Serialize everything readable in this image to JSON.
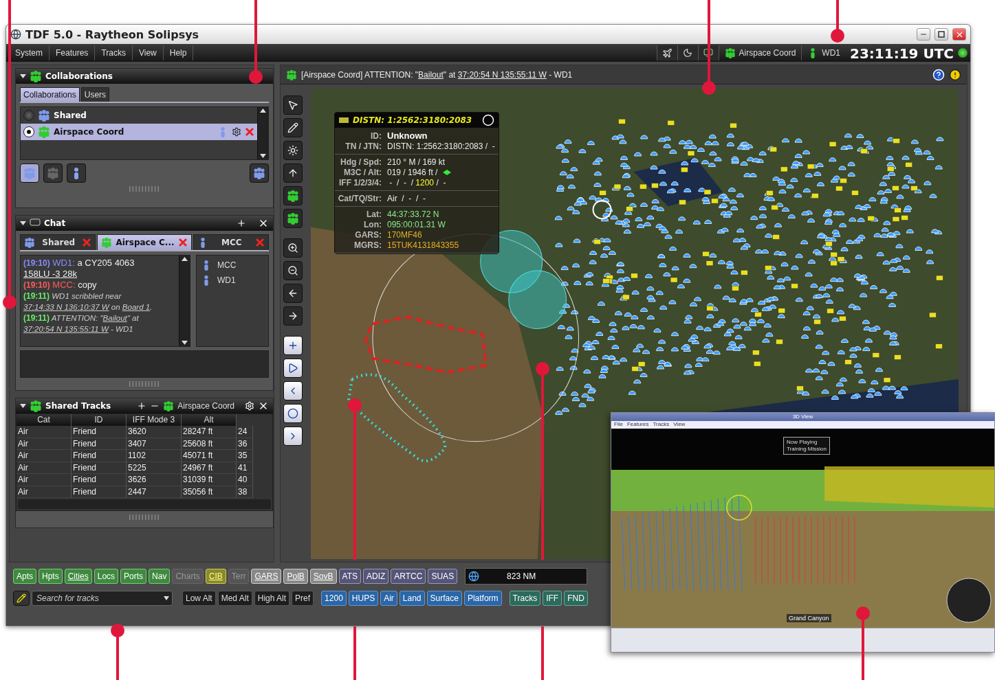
{
  "window": {
    "title": "TDF 5.0 - Raytheon Solipsys"
  },
  "menu": [
    "System",
    "Features",
    "Tracks",
    "View",
    "Help"
  ],
  "status": {
    "collaboration": "Airspace Coord",
    "user": "WD1",
    "clock": "23:11:19 UTC"
  },
  "alert": [
    {
      "text": "[Airspace Coord] ATTENTION: \"",
      "link": false
    },
    {
      "text": "Bailout",
      "link": true
    },
    {
      "text": "\" at ",
      "link": false
    },
    {
      "text": "37:20:54 N 135:55:11 W",
      "link": true
    },
    {
      "text": " - WD1",
      "link": false
    }
  ],
  "collaborations": {
    "title": "Collaborations",
    "tabs": [
      {
        "label": "Collaborations",
        "selected": true
      },
      {
        "label": "Users",
        "selected": false
      }
    ],
    "items": [
      {
        "name": "Shared",
        "selected": false,
        "color": "#7f9be8"
      },
      {
        "name": "Airspace Coord",
        "selected": true,
        "color": "#33cc33"
      }
    ]
  },
  "chat": {
    "title": "Chat",
    "tabs": [
      {
        "label": "Shared",
        "selected": false,
        "color": "#7f9be8"
      },
      {
        "label": "Airspace C...",
        "selected": true,
        "color": "#33cc33"
      },
      {
        "label": "MCC",
        "selected": false,
        "color": "#7f9be8"
      }
    ],
    "messages": [
      {
        "kind": "message",
        "time": "(19:10)",
        "sender": "WD1:",
        "color": "#8a8aff",
        "parts": [
          {
            "text": "a CY205 4063 ",
            "link": false
          },
          {
            "text": "158LU -3 28k",
            "link": true
          }
        ]
      },
      {
        "kind": "message",
        "time": "(19:10)",
        "sender": "MCC:",
        "color": "#ff5a5a",
        "parts": [
          {
            "text": "copy",
            "link": false
          }
        ]
      },
      {
        "kind": "event",
        "time": "(19:11)",
        "color": "#66ee66",
        "parts": [
          {
            "text": "WD1 scribbled near ",
            "link": false
          },
          {
            "text": "37:14:33 N 136:10:37 W",
            "link": true
          },
          {
            "text": " on ",
            "link": false
          },
          {
            "text": "Board 1",
            "link": true
          },
          {
            "text": ".",
            "link": false
          }
        ]
      },
      {
        "kind": "event",
        "time": "(19:11)",
        "color": "#66ee66",
        "parts": [
          {
            "text": "ATTENTION: \"",
            "link": false
          },
          {
            "text": "Bailout",
            "link": true
          },
          {
            "text": "\" at ",
            "link": false
          },
          {
            "text": "37:20:54 N 135:55:11 W",
            "link": true
          },
          {
            "text": " - WD1",
            "link": false
          }
        ]
      }
    ],
    "users": [
      "MCC",
      "WD1"
    ]
  },
  "shared_tracks": {
    "title": "Shared Tracks",
    "collaboration": "Airspace Coord",
    "columns": [
      "Cat",
      "ID",
      "IFF Mode 3",
      "Alt"
    ],
    "rows": [
      [
        "Air",
        "Friend",
        "3620",
        "28247 ft",
        "24"
      ],
      [
        "Air",
        "Friend",
        "3407",
        "25608 ft",
        "36"
      ],
      [
        "Air",
        "Friend",
        "1102",
        "45071 ft",
        "35"
      ],
      [
        "Air",
        "Friend",
        "5225",
        "24967 ft",
        "41"
      ],
      [
        "Air",
        "Friend",
        "3626",
        "31039 ft",
        "40"
      ],
      [
        "Air",
        "Friend",
        "2447",
        "35056 ft",
        "38"
      ]
    ]
  },
  "track_popup": {
    "title": "DISTN: 1:2562:3180:2083",
    "groups": [
      [
        {
          "label": "ID:",
          "parts": [
            {
              "text": "Unknown",
              "kind": "bold"
            }
          ]
        },
        {
          "label": "TN / JTN:",
          "parts": [
            {
              "text": "DISTN: 1:2562:3180:2083 /  -",
              "kind": "plain"
            }
          ]
        }
      ],
      [
        {
          "label": "Hdg / Spd:",
          "parts": [
            {
              "text": "210 ° M / 169 kt",
              "kind": "plain"
            }
          ]
        },
        {
          "label": "M3C / Alt:",
          "parts": [
            {
              "text": "019 / 1946 ft /",
              "kind": "plain"
            }
          ]
        },
        {
          "label": "IFF 1/2/3/4:",
          "parts": [
            {
              "text": " -  /  -  / ",
              "kind": "plain"
            },
            {
              "text": "1200",
              "kind": "yellow"
            },
            {
              "text": " /  -",
              "kind": "plain"
            }
          ]
        }
      ],
      [
        {
          "label": "Cat/TQ/Str:",
          "parts": [
            {
              "text": "Air  /  -  /  -",
              "kind": "plain"
            }
          ]
        }
      ],
      [
        {
          "label": "Lat:",
          "parts": [
            {
              "text": "44:37:33.72 N",
              "kind": "green"
            }
          ]
        },
        {
          "label": "Lon:",
          "parts": [
            {
              "text": "095:00:01.31 W",
              "kind": "green"
            }
          ]
        },
        {
          "label": "GARS:",
          "parts": [
            {
              "text": "170MF46",
              "kind": "orange"
            }
          ]
        },
        {
          "label": "MGRS:",
          "parts": [
            {
              "text": "15TUK4131843355",
              "kind": "orange"
            }
          ]
        }
      ]
    ]
  },
  "layers": [
    {
      "label": "Apts",
      "kind": "green",
      "disabled": false,
      "underlined": false
    },
    {
      "label": "Hpts",
      "kind": "green",
      "disabled": false,
      "underlined": false
    },
    {
      "label": "Cities",
      "kind": "green",
      "disabled": false,
      "underlined": true
    },
    {
      "label": "Locs",
      "kind": "green",
      "disabled": false,
      "underlined": false
    },
    {
      "label": "Ports",
      "kind": "green",
      "disabled": false,
      "underlined": false
    },
    {
      "label": "Nav",
      "kind": "green",
      "disabled": false,
      "underlined": false
    },
    {
      "label": "Charts",
      "kind": "green",
      "disabled": true,
      "underlined": false
    },
    {
      "label": "CIB",
      "kind": "olive",
      "disabled": false,
      "underlined": true
    },
    {
      "label": "Terr",
      "kind": "olive",
      "disabled": true,
      "underlined": false
    },
    {
      "label": "GARS",
      "kind": "white",
      "disabled": false,
      "underlined": true
    },
    {
      "label": "PolB",
      "kind": "white",
      "disabled": false,
      "underlined": true
    },
    {
      "label": "SovB",
      "kind": "white",
      "disabled": false,
      "underlined": true
    },
    {
      "label": "ATS",
      "kind": "purple",
      "disabled": false,
      "underlined": false
    },
    {
      "label": "ADIZ",
      "kind": "purple",
      "disabled": false,
      "underlined": false
    },
    {
      "label": "ARTCC",
      "kind": "purple",
      "disabled": false,
      "underlined": false
    },
    {
      "label": "SUAS",
      "kind": "purple",
      "disabled": false,
      "underlined": false
    }
  ],
  "scale": {
    "reading": "823 NM"
  },
  "search": {
    "placeholder": "Search for tracks"
  },
  "filter_groups": [
    {
      "kind": "dark",
      "buttons": [
        "Low Alt",
        "Med Alt",
        "High Alt",
        "Pref"
      ]
    },
    {
      "kind": "blue",
      "buttons": [
        "1200",
        "HUPS",
        "Air",
        "Land",
        "Surface",
        "Platform"
      ]
    },
    {
      "kind": "teal",
      "buttons": [
        "Tracks",
        "IFF",
        "FND"
      ]
    }
  ],
  "view_3d": {
    "title": "3D View",
    "menu": [
      "File",
      "Features",
      "Tracks",
      "View"
    ],
    "banner": [
      "Now Playing",
      "Training Mission"
    ],
    "place": "Grand Canyon"
  }
}
